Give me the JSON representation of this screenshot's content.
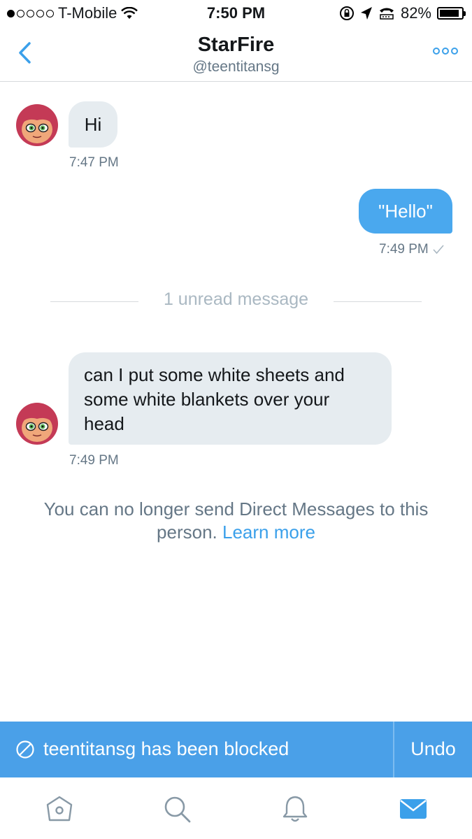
{
  "status_bar": {
    "carrier": "T-Mobile",
    "time": "7:50 PM",
    "battery": "82%",
    "battery_level": 0.82
  },
  "header": {
    "back_icon": "chevron-left-icon",
    "title": "StarFire",
    "handle": "@teentitansg",
    "more_icon": "more-dots-icon"
  },
  "messages": [
    {
      "direction": "incoming",
      "text": "Hi",
      "time": "7:47 PM"
    },
    {
      "direction": "outgoing",
      "text": "\"Hello\"",
      "time": "7:49 PM",
      "status_icon": "check-icon"
    },
    {
      "direction": "incoming",
      "lines": [
        "can I put some white sheets and",
        "some white blankets over your",
        "head"
      ],
      "time": "7:49 PM"
    }
  ],
  "unread_divider": "1 unread message",
  "notice": {
    "text": "You can no longer send Direct Messages to this person.",
    "line1": "You can no longer send Direct Messages to this",
    "line2": "person.",
    "link": "Learn more"
  },
  "banner": {
    "icon": "blocked-icon",
    "text": "teentitansg has been blocked",
    "action": "Undo"
  },
  "tab_bar": {
    "items": [
      {
        "name": "home",
        "icon": "home-icon"
      },
      {
        "name": "search",
        "icon": "search-icon"
      },
      {
        "name": "notifications",
        "icon": "bell-icon"
      },
      {
        "name": "messages",
        "icon": "mail-icon",
        "active": true
      }
    ]
  },
  "colors": {
    "accent": "#1da1f2",
    "outgoing_bubble": "#4aa8ee",
    "incoming_bubble": "#e6ecf0",
    "banner": "#4aa0e8",
    "muted_text": "#657786"
  }
}
